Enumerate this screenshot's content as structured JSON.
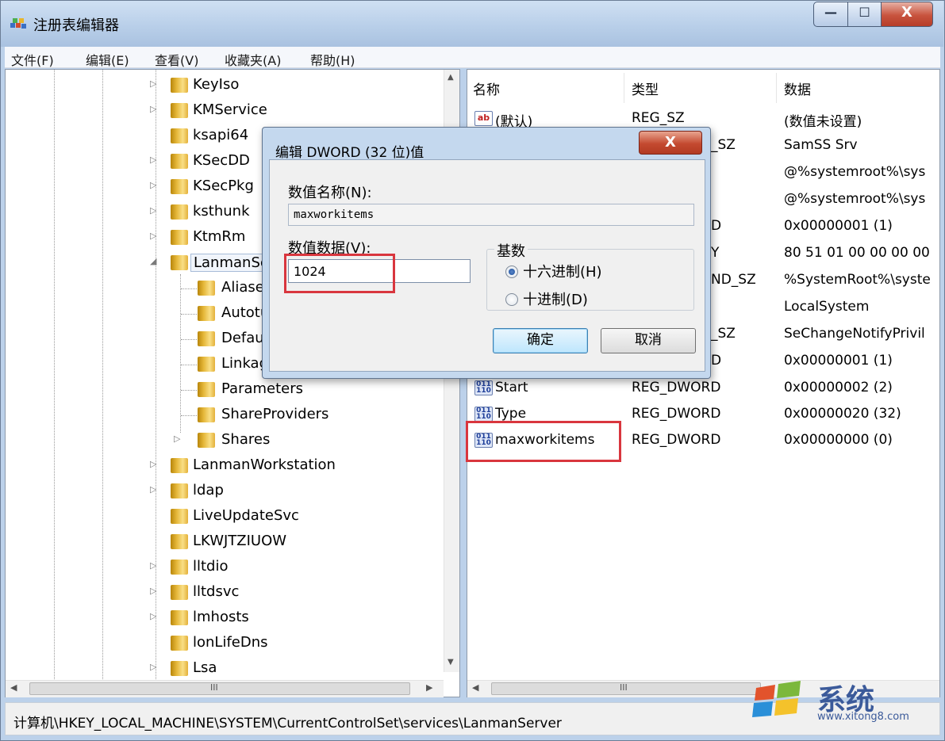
{
  "window": {
    "title": "注册表编辑器",
    "minimize_glyph": "—",
    "maximize_glyph": "☐",
    "close_glyph": "X"
  },
  "menu": [
    "文件(F)",
    "编辑(E)",
    "查看(V)",
    "收藏夹(A)",
    "帮助(H)"
  ],
  "tree": {
    "items": [
      {
        "label": "KeyIso"
      },
      {
        "label": "KMService"
      },
      {
        "label": "ksapi64"
      },
      {
        "label": "KSecDD"
      },
      {
        "label": "KSecPkg"
      },
      {
        "label": "ksthunk"
      },
      {
        "label": "KtmRm"
      },
      {
        "label": "LanmanSer"
      },
      {
        "label": "Aliases"
      },
      {
        "label": "Autotur"
      },
      {
        "label": "Default"
      },
      {
        "label": "Linkage"
      },
      {
        "label": "Parameters"
      },
      {
        "label": "ShareProviders"
      },
      {
        "label": "Shares"
      },
      {
        "label": "LanmanWorkstation"
      },
      {
        "label": "ldap"
      },
      {
        "label": "LiveUpdateSvc"
      },
      {
        "label": "LKWJTZIUOW"
      },
      {
        "label": "lltdio"
      },
      {
        "label": "lltdsvc"
      },
      {
        "label": "lmhosts"
      },
      {
        "label": "lonLifeDns"
      },
      {
        "label": "Lsa"
      }
    ],
    "hscroll_glyph": "III"
  },
  "list": {
    "headers": {
      "name": "名称",
      "type": "类型",
      "data": "数据"
    },
    "rows": [
      {
        "name": "(默认)",
        "type": "REG_SZ",
        "data": "(数值未设置)",
        "icon": "ab"
      },
      {
        "name": "",
        "type": "_SZ",
        "data": "SamSS Srv",
        "icon": ""
      },
      {
        "name": "",
        "type": "",
        "data": "@%systemroot%\\sys",
        "icon": ""
      },
      {
        "name": "",
        "type": "",
        "data": "@%systemroot%\\sys",
        "icon": ""
      },
      {
        "name": "",
        "type": "D",
        "data": "0x00000001 (1)",
        "icon": ""
      },
      {
        "name": "",
        "type": "Y",
        "data": "80 51 01 00 00 00 00",
        "icon": ""
      },
      {
        "name": "",
        "type": "ND_SZ",
        "data": "%SystemRoot%\\syste",
        "icon": ""
      },
      {
        "name": "",
        "type": "",
        "data": "LocalSystem",
        "icon": ""
      },
      {
        "name": "",
        "type": "_SZ",
        "data": "SeChangeNotifyPrivil",
        "icon": ""
      },
      {
        "name": "",
        "type": "D",
        "data": "0x00000001 (1)",
        "icon": ""
      },
      {
        "name": "Start",
        "type": "REG_DWORD",
        "data": "0x00000002 (2)",
        "icon": "011\n110"
      },
      {
        "name": "Type",
        "type": "REG_DWORD",
        "data": "0x00000020 (32)",
        "icon": "011\n110"
      },
      {
        "name": "maxworkitems",
        "type": "REG_DWORD",
        "data": "0x00000000 (0)",
        "icon": "011\n110"
      }
    ],
    "hscroll_glyph": "III"
  },
  "dialog": {
    "title": "编辑 DWORD (32 位)值",
    "close_glyph": "X",
    "name_label": "数值名称(N):",
    "name_value": "maxworkitems",
    "data_label": "数值数据(V):",
    "data_value": "1024",
    "base_label": "基数",
    "hex_label": "十六进制(H)",
    "dec_label": "十进制(D)",
    "hex_selected": true,
    "ok_label": "确定",
    "cancel_label": "取消"
  },
  "status": {
    "path": "计算机\\HKEY_LOCAL_MACHINE\\SYSTEM\\CurrentControlSet\\services\\LanmanServer"
  },
  "watermark": {
    "chars": "系统",
    "url": "www.xitong8.com"
  },
  "colors": {
    "highlight_box": "#d9363e",
    "title_bar": "#bcd1ea",
    "folder": "#e6b83a"
  }
}
